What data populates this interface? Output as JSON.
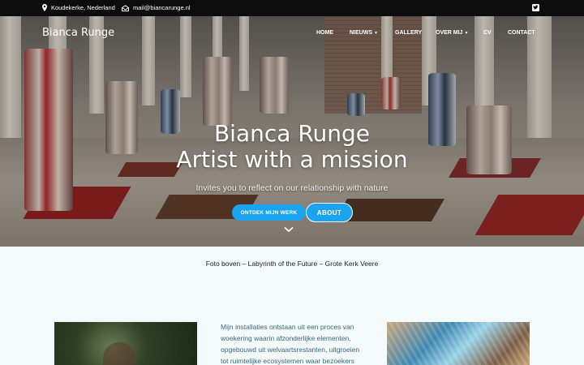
{
  "topbar": {
    "location": "Koudekerke, Nederland",
    "email": "mail@biancarunge.nl"
  },
  "site": {
    "brand": "Bianca Runge"
  },
  "nav": {
    "home": "HOME",
    "nieuws": "NIEUWS",
    "gallery": "GALLERY",
    "over_mij": "OVER MIJ",
    "cv": "CV",
    "contact": "CONTACT"
  },
  "hero": {
    "title_line1": "Bianca Runge",
    "title_line2": "Artist with a mission",
    "subtitle": "Invites you to reflect on our relationship with nature",
    "button_primary": "ONTDEK MIJN WERK",
    "button_secondary": "ABOUT"
  },
  "caption": "Foto boven – Labyrinth of the Future – Grote Kerk Veere",
  "intro": {
    "lines": [
      "Mijn installaties ontstaan uit een proces van",
      "woekering waarin afzonderlijke elementen,",
      "opgebouwd uit welvaartsrestanten,  uitgroeien",
      "tot ruimtelijke ecosystemen waar bezoekers"
    ]
  },
  "colors": {
    "accent": "#1aa3ee",
    "topbar": "#0d0d0d",
    "text_teal": "#3a6a74"
  },
  "icons": {
    "location": "map-pin-icon",
    "email": "envelope-icon",
    "social": "twitter-icon",
    "scroll": "chevron-down-icon"
  }
}
